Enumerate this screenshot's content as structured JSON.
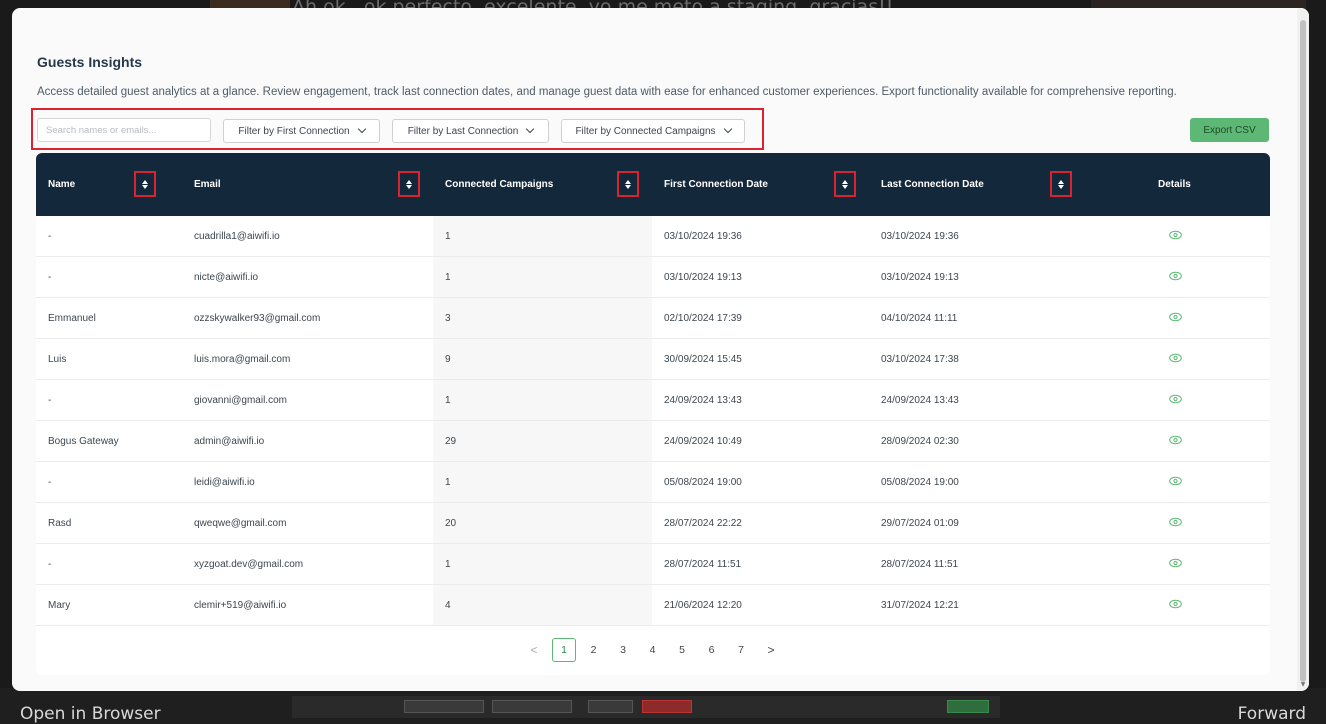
{
  "background": {
    "top_text": "Ah ok , ok perfecto, excelente, yo me meto a staging, gracias!!",
    "open_in_browser": "Open in Browser",
    "forward": "Forward"
  },
  "page": {
    "title": "Guests Insights",
    "description": "Access detailed guest analytics at a glance. Review engagement, track last connection dates, and manage guest data with ease for enhanced customer experiences. Export functionality available for comprehensive reporting."
  },
  "filters": {
    "search_placeholder": "Search names or emails...",
    "first_connection": "Filter by First Connection",
    "last_connection": "Filter by Last Connection",
    "connected_campaigns": "Filter by Connected Campaigns",
    "export_label": "Export CSV"
  },
  "table": {
    "headers": {
      "name": "Name",
      "email": "Email",
      "campaigns": "Connected Campaigns",
      "first": "First Connection Date",
      "last": "Last Connection Date",
      "details": "Details"
    },
    "rows": [
      {
        "name": "-",
        "email": "cuadrilla1@aiwifi.io",
        "campaigns": "1",
        "first": "03/10/2024 19:36",
        "last": "03/10/2024 19:36"
      },
      {
        "name": "-",
        "email": "nicte@aiwifi.io",
        "campaigns": "1",
        "first": "03/10/2024 19:13",
        "last": "03/10/2024 19:13"
      },
      {
        "name": "Emmanuel",
        "email": "ozzskywalker93@gmail.com",
        "campaigns": "3",
        "first": "02/10/2024 17:39",
        "last": "04/10/2024 11:11"
      },
      {
        "name": "Luis",
        "email": "luis.mora@gmail.com",
        "campaigns": "9",
        "first": "30/09/2024 15:45",
        "last": "03/10/2024 17:38"
      },
      {
        "name": "-",
        "email": "giovanni@gmail.com",
        "campaigns": "1",
        "first": "24/09/2024 13:43",
        "last": "24/09/2024 13:43"
      },
      {
        "name": "Bogus Gateway",
        "email": "admin@aiwifi.io",
        "campaigns": "29",
        "first": "24/09/2024 10:49",
        "last": "28/09/2024 02:30"
      },
      {
        "name": "-",
        "email": "leidi@aiwifi.io",
        "campaigns": "1",
        "first": "05/08/2024 19:00",
        "last": "05/08/2024 19:00"
      },
      {
        "name": "Rasd",
        "email": "qweqwe@gmail.com",
        "campaigns": "20",
        "first": "28/07/2024 22:22",
        "last": "29/07/2024 01:09"
      },
      {
        "name": "-",
        "email": "xyzgoat.dev@gmail.com",
        "campaigns": "1",
        "first": "28/07/2024 11:51",
        "last": "28/07/2024 11:51"
      },
      {
        "name": "Mary",
        "email": "clemir+519@aiwifi.io",
        "campaigns": "4",
        "first": "21/06/2024 12:20",
        "last": "31/07/2024 12:21"
      }
    ]
  },
  "pagination": {
    "prev": "<",
    "pages": [
      "1",
      "2",
      "3",
      "4",
      "5",
      "6",
      "7"
    ],
    "current": "1",
    "next": ">"
  },
  "colors": {
    "header_bg": "#14283b",
    "accent_green": "#5cb874",
    "highlight_red": "#d9232e"
  }
}
